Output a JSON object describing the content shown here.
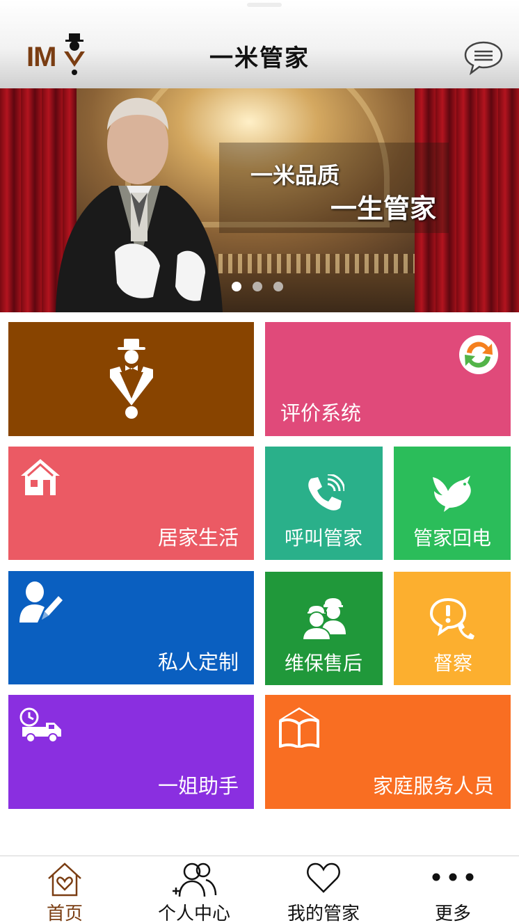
{
  "header": {
    "logo_text": "IM",
    "title": "一米管家",
    "message_icon": "chat-bubble-icon"
  },
  "banner": {
    "slogan_line1": "一米品质",
    "slogan_line2": "一生管家",
    "slide_count": 3,
    "active_slide": 1
  },
  "tiles": {
    "main_icon": "butler-icon",
    "rating": {
      "label": "评价系统",
      "icon": "refresh-arrows-icon"
    },
    "home_life": {
      "label": "居家生活",
      "icon": "house-icon"
    },
    "call_butler": {
      "label": "呼叫管家",
      "icon": "phone-icon"
    },
    "callback": {
      "label": "管家回电",
      "icon": "dove-icon"
    },
    "private_custom": {
      "label": "私人定制",
      "icon": "user-edit-icon"
    },
    "maintenance": {
      "label": "维保售后",
      "icon": "workers-icon"
    },
    "supervision": {
      "label": "督察",
      "icon": "alert-phone-icon"
    },
    "assistant": {
      "label": "一姐助手",
      "icon": "delivery-truck-icon"
    },
    "home_staff": {
      "label": "家庭服务人员",
      "icon": "book-icon"
    }
  },
  "colors": {
    "brand_brown": "#884400",
    "pink": "#e04a7a",
    "coral": "#eb5a64",
    "teal": "#2ab08a",
    "green": "#2bbd5a",
    "blue": "#0a5fc0",
    "dark_green": "#20983a",
    "amber": "#fcaf2f",
    "purple": "#8a2fe0",
    "orange": "#f96e22"
  },
  "bottom_nav": {
    "items": [
      {
        "label": "首页",
        "icon": "home-heart-icon",
        "active": true
      },
      {
        "label": "个人中心",
        "icon": "users-add-icon",
        "active": false
      },
      {
        "label": "我的管家",
        "icon": "heart-icon",
        "active": false
      },
      {
        "label": "更多",
        "icon": "more-dots-icon",
        "active": false
      }
    ]
  }
}
